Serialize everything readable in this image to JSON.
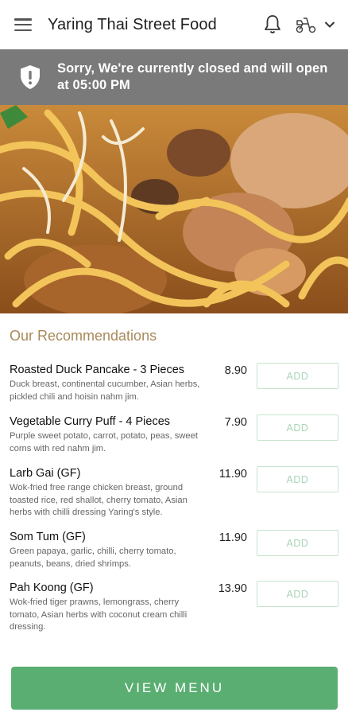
{
  "header": {
    "title": "Yaring Thai Street Food",
    "menu_icon": "hamburger-menu-icon",
    "bell_icon": "bell-icon",
    "delivery_icon": "scooter-icon",
    "dropdown_icon": "chevron-down-icon"
  },
  "banner": {
    "icon": "shield-alert-icon",
    "message": "Sorry, We're currently closed and will open at 05:00 PM"
  },
  "recommendations": {
    "title": "Our Recommendations",
    "items": [
      {
        "name": "Roasted Duck Pancake - 3 Pieces",
        "description": "Duck breast, continental cucumber, Asian herbs, pickled chili and hoisin nahm jim.",
        "price": "8.90",
        "add_label": "ADD"
      },
      {
        "name": "Vegetable Curry Puff - 4 Pieces",
        "description": "Purple sweet potato, carrot, potato, peas, sweet corns with red nahm jim.",
        "price": "7.90",
        "add_label": "ADD"
      },
      {
        "name": "Larb Gai (GF)",
        "description": "Wok-fried free range chicken breast, ground toasted rice, red shallot, cherry tomato, Asian herbs with chilli dressing Yaring's style.",
        "price": "11.90",
        "add_label": "ADD"
      },
      {
        "name": "Som Tum (GF)",
        "description": "Green papaya, garlic, chilli, cherry tomato, peanuts, beans, dried shrimps.",
        "price": "11.90",
        "add_label": "ADD"
      },
      {
        "name": "Pah Koong (GF)",
        "description": "Wok-fried tiger prawns, lemongrass, cherry tomato, Asian herbs with coconut cream chilli dressing.",
        "price": "13.90",
        "add_label": "ADD"
      }
    ]
  },
  "footer": {
    "view_menu_label": "VIEW MENU"
  },
  "colors": {
    "accent_green": "#5aae72",
    "banner_gray": "#7a7a7a",
    "section_title": "#a88a5a"
  }
}
